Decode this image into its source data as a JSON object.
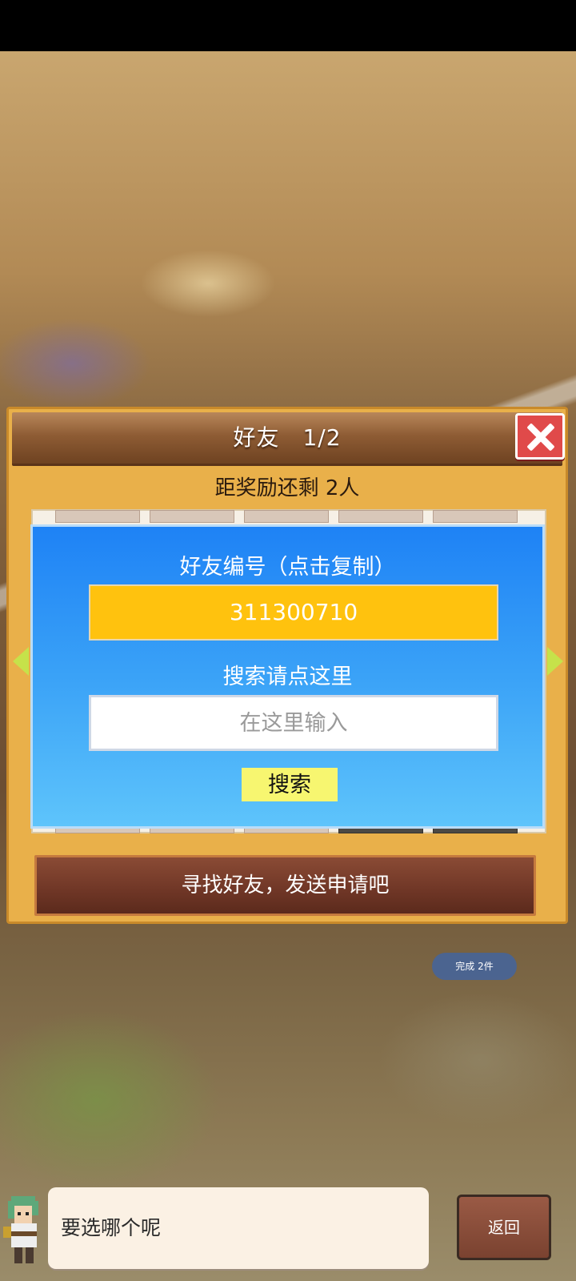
{
  "panel": {
    "title": "好友　1/2",
    "reward": "距奖励还剩 2人",
    "find_button": "寻找好友，发送申请吧"
  },
  "dialog": {
    "id_label": "好友编号（点击复制）",
    "friend_id": "311300710",
    "search_label": "搜索请点这里",
    "input_placeholder": "在这里输入",
    "search_button": "搜索"
  },
  "background": {
    "done_badge": "完成 2件"
  },
  "footer": {
    "speech": "要选哪个呢",
    "back_button": "返回"
  },
  "colors": {
    "panel_bg": "#e9b04a",
    "dialog_top": "#1e82f5",
    "dialog_bottom": "#5ec4fb",
    "id_box": "#ffc20e",
    "search_button": "#f7f670",
    "close_button": "#e04a4a"
  },
  "icons": {
    "close": "close-icon",
    "prev": "arrow-left-icon",
    "next": "arrow-right-icon"
  }
}
